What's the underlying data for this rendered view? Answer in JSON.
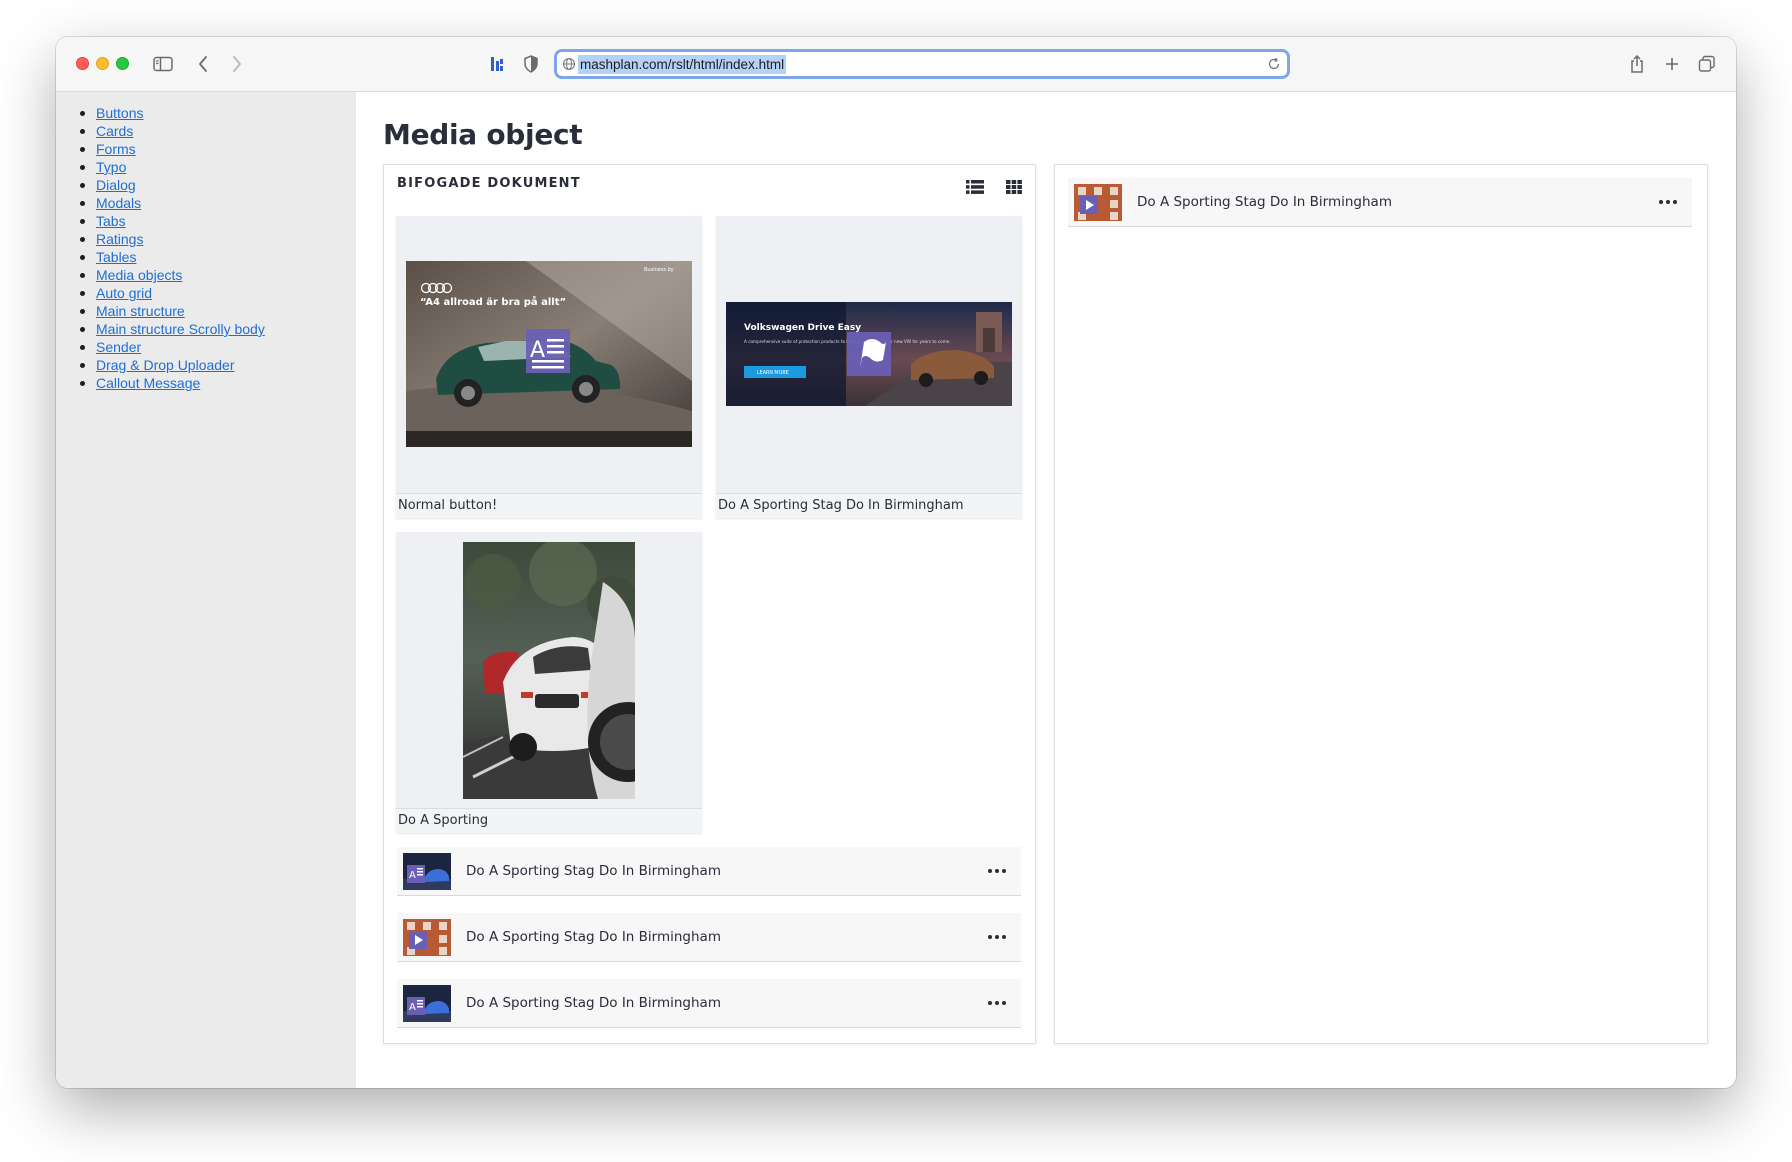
{
  "browser": {
    "url": "mashplan.com/rslt/html/index.html"
  },
  "sidebar": {
    "items": [
      {
        "label": "Buttons"
      },
      {
        "label": "Cards"
      },
      {
        "label": "Forms"
      },
      {
        "label": "Typo"
      },
      {
        "label": "Dialog"
      },
      {
        "label": "Modals"
      },
      {
        "label": "Tabs"
      },
      {
        "label": "Ratings"
      },
      {
        "label": "Tables"
      },
      {
        "label": "Media objects"
      },
      {
        "label": "Auto grid"
      },
      {
        "label": "Main structure"
      },
      {
        "label": "Main structure Scrolly body"
      },
      {
        "label": "Sender"
      },
      {
        "label": "Drag & Drop Uploader"
      },
      {
        "label": "Callout Message"
      }
    ]
  },
  "page": {
    "title": "Media object"
  },
  "attachments_panel": {
    "title": "BIFOGADE DOKUMENT",
    "cards": [
      {
        "caption": "Normal button!",
        "ad_title": "“A4 allroad är bra på allt”",
        "ad_badge": "Business by",
        "icon": "document-icon"
      },
      {
        "caption": "Do A Sporting Stag Do In Birmingham",
        "ad_title": "Volkswagen Drive Easy",
        "ad_text": "A comprehensive suite of protection products to help you care for your new VW for years to come.",
        "ad_button": "LEARN MORE",
        "icon": "flag-icon"
      },
      {
        "caption": "Do A Sporting",
        "icon": "photo"
      }
    ],
    "list": [
      {
        "title": "Do A Sporting Stag Do In Birmingham",
        "icon": "document-icon"
      },
      {
        "title": "Do A Sporting Stag Do In Birmingham",
        "icon": "video-icon"
      },
      {
        "title": "Do A Sporting Stag Do In Birmingham",
        "icon": "document-icon"
      }
    ]
  },
  "right_panel": {
    "list": [
      {
        "title": "Do A Sporting Stag Do In Birmingham",
        "icon": "video-icon"
      }
    ]
  },
  "colors": {
    "link": "#1d6fd6",
    "icon_overlay": "#6a5fb5",
    "sidebar_bg": "#ebebeb",
    "title": "#2a2d3a"
  }
}
